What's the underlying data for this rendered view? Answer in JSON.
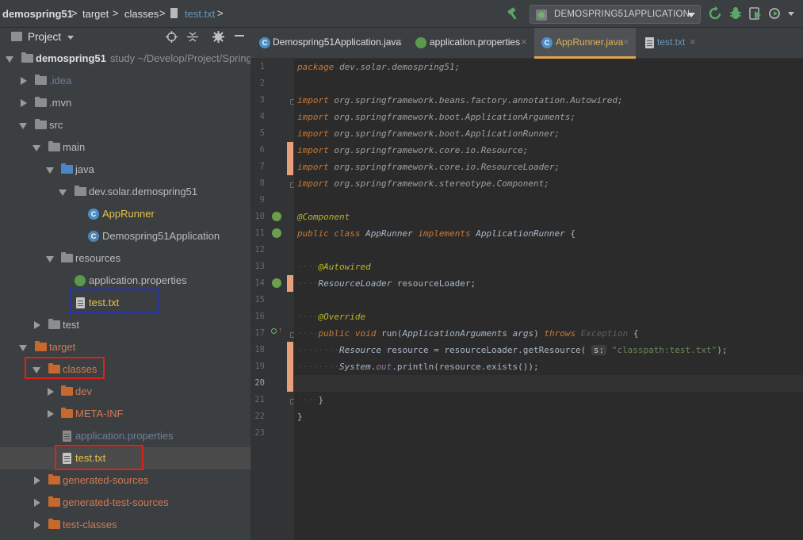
{
  "breadcrumbs": {
    "project": "demospring51",
    "dir1": "target",
    "dir2": "classes",
    "file": "test.txt",
    "sep": ">"
  },
  "toolbar": {
    "run_config": "DEMOSPRING51APPLICATION",
    "icons": [
      "hammer-icon",
      "spring-boot-icon",
      "rerun-icon",
      "debug-icon",
      "coverage-icon",
      "profile-icon"
    ]
  },
  "project_panel": {
    "title": "Project",
    "tree": [
      {
        "label": "demospring51",
        "extra": "study   ~/Develop/Project/Spring",
        "icon": "module-folder"
      },
      {
        "label": ".idea",
        "icon": "folder"
      },
      {
        "label": ".mvn",
        "icon": "folder"
      },
      {
        "label": "src",
        "icon": "folder"
      },
      {
        "label": "main",
        "icon": "folder"
      },
      {
        "label": "java",
        "icon": "source-folder"
      },
      {
        "label": "dev.solar.demospring51",
        "icon": "package"
      },
      {
        "label": "AppRunner",
        "icon": "class"
      },
      {
        "label": "Demospring51Application",
        "icon": "spring-class"
      },
      {
        "label": "resources",
        "icon": "resource-folder"
      },
      {
        "label": "application.properties",
        "icon": "spring-properties"
      },
      {
        "label": "test.txt",
        "icon": "text-file"
      },
      {
        "label": "test",
        "icon": "folder"
      },
      {
        "label": "target",
        "icon": "excluded-folder"
      },
      {
        "label": "classes",
        "icon": "excluded-folder"
      },
      {
        "label": "dev",
        "icon": "excluded-folder"
      },
      {
        "label": "META-INF",
        "icon": "excluded-folder"
      },
      {
        "label": "application.properties",
        "icon": "properties"
      },
      {
        "label": "test.txt",
        "icon": "text-file"
      },
      {
        "label": "generated-sources",
        "icon": "excluded-folder"
      },
      {
        "label": "generated-test-sources",
        "icon": "excluded-folder"
      },
      {
        "label": "test-classes",
        "icon": "excluded-folder"
      }
    ]
  },
  "tabs": [
    {
      "label": "Demospring51Application.java",
      "active": false
    },
    {
      "label": "application.properties",
      "active": false
    },
    {
      "label": "AppRunner.java",
      "active": true
    },
    {
      "label": "test.txt",
      "active": false
    }
  ],
  "gutter": {
    "line_numbers": [
      "1",
      "2",
      "3",
      "4",
      "5",
      "6",
      "7",
      "8",
      "9",
      "10",
      "11",
      "12",
      "13",
      "14",
      "15",
      "16",
      "17",
      "18",
      "19",
      "20",
      "21",
      "22",
      "23"
    ],
    "current_line": "20"
  },
  "code": {
    "l1_kw": "package",
    "l1_rest": " dev.solar.demospring51;",
    "import_kw": "import",
    "l3": " org.springframework.beans.factory.annotation.Autowired;",
    "l4": " org.springframework.boot.ApplicationArguments;",
    "l5": " org.springframework.boot.ApplicationRunner;",
    "l6": " org.springframework.core.io.Resource;",
    "l7": " org.springframework.core.io.ResourceLoader;",
    "l8": " org.springframework.stereotype.Component;",
    "l10": "@Component",
    "l11_public": "public",
    "l11_class": " class",
    "l11_name": " AppRunner",
    "l11_impl": " implements",
    "l11_iface": " ApplicationRunner",
    "l11_brace": " {",
    "l13": "@Autowired",
    "l14_type": "ResourceLoader",
    "l14_rest": " resourceLoader;",
    "l16": "@Override",
    "l17_public": "public",
    "l17_void": " void",
    "l17_name": " run(",
    "l17_ptype": "ApplicationArguments",
    "l17_pname": " args",
    "l17_close": ")",
    "l17_throws": " throws",
    "l17_exc": " Exception",
    "l17_brace": " {",
    "l18_type": "Resource",
    "l18_mid": " resource = resourceLoader.getResource(",
    "l18_hint": "s:",
    "l18_str": "\"classpath:test.txt\"",
    "l18_end": ");",
    "l19_sys": "System",
    "l19_dot": ".",
    "l19_out": "out",
    "l19_rest": ".println(resource.exists());",
    "l21": "}",
    "l22": "}",
    "indent1": "····",
    "indent2": "········"
  }
}
